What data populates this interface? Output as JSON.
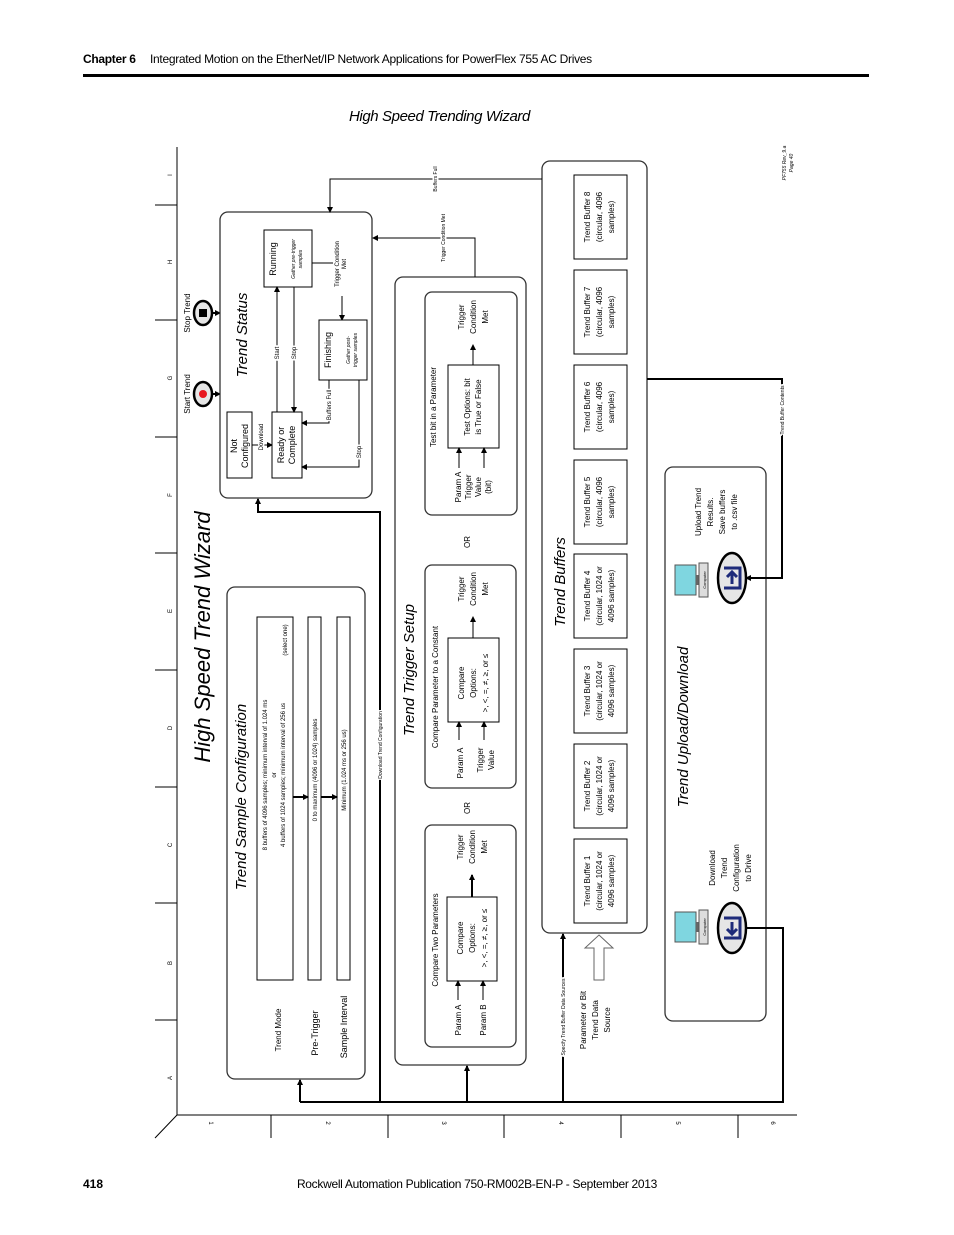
{
  "header": {
    "chapter": "Chapter 6",
    "title": "Integrated Motion on the EtherNet/IP Network Applications for PowerFlex 755 AC Drives"
  },
  "figure_title": "High Speed Trending Wizard",
  "diagram": {
    "title": "High Speed Trend Wizard",
    "grid": {
      "columns": [
        "A",
        "B",
        "C",
        "D",
        "E",
        "F",
        "G",
        "H",
        "I"
      ],
      "rows": [
        "1",
        "2",
        "3",
        "4",
        "5",
        "6"
      ]
    },
    "revision": [
      "PF755 Rev_9.a",
      "Page 40"
    ],
    "controls": {
      "start": "Start Trend",
      "stop": "Stop Trend",
      "start_color": "#e8171f"
    },
    "trend_status": {
      "title": "Trend Status",
      "not_configured": [
        "Not",
        "Configured"
      ],
      "download": "Download",
      "ready": [
        "Ready or",
        "Complete"
      ],
      "running": "Running",
      "running_note": [
        "Gather pre-trigger",
        "samples"
      ],
      "finishing": "Finishing",
      "finishing_note": [
        "Gather post-",
        "trigger samples"
      ],
      "start": "Start",
      "stop": "Stop",
      "buffers_full": "Buffers Full",
      "stop_finishing": "Stop",
      "trigger_met": [
        "Trigger Condition",
        "Met"
      ]
    },
    "sample_config": {
      "title": "Trend Sample Configuration",
      "trend_mode": "Trend Mode",
      "trend_mode_options": [
        "8 buffers of 4096 samples; minimum interval of 1.024 ms",
        "or",
        "4 buffers of 1024 samples; minimum interval of 256 us"
      ],
      "select_one": "(select one)",
      "pre_trigger": "Pre-Trigger",
      "pre_trigger_value": "0 to maximum (4096 or 1024) samples",
      "sample_interval": "Sample Interval",
      "sample_interval_value": "Minimum (1.024 ms or 256 us)"
    },
    "trigger_setup": {
      "title": "Trend Trigger Setup",
      "or": "OR",
      "two_params": {
        "title": "Compare Two Parameters",
        "options": [
          "Compare",
          "Options:",
          ">, <, =, ≠, ≥, or ≤"
        ],
        "param_a": "Param A",
        "param_b": "Param B",
        "result": [
          "Trigger",
          "Condition",
          "Met"
        ]
      },
      "constant": {
        "title": "Compare Parameter to a Constant",
        "options": [
          "Compare",
          "Options:",
          ">, <, =, ≠, ≥, or ≤"
        ],
        "param_a": "Param A",
        "trigger_value": [
          "Trigger",
          "Value"
        ],
        "result": [
          "Trigger",
          "Condition",
          "Met"
        ]
      },
      "bit": {
        "title": "Test bit in a Parameter",
        "options": [
          "Test Options: bit",
          "is True or False"
        ],
        "inputs": [
          "Param A",
          "Trigger",
          "Value",
          "(bit)"
        ],
        "result": [
          "Trigger",
          "Condition",
          "Met"
        ]
      }
    },
    "buffers": {
      "title": "Trend Buffers",
      "items": [
        [
          "Trend Buffer 1",
          "(circular, 1024 or",
          "4096 samples)"
        ],
        [
          "Trend Buffer 2",
          "(circular, 1024 or",
          "4096 samples)"
        ],
        [
          "Trend Buffer 3",
          "(circular, 1024 or",
          "4096 samples)"
        ],
        [
          "Trend Buffer 4",
          "(circular, 1024 or",
          "4096 samples)"
        ],
        [
          "Trend Buffer 5",
          "(circular, 4096",
          "samples)"
        ],
        [
          "Trend Buffer 6",
          "(circular, 4096",
          "samples)"
        ],
        [
          "Trend Buffer 7",
          "(circular, 4096",
          "samples)"
        ],
        [
          "Trend Buffer 8",
          "(circular, 4096",
          "samples)"
        ]
      ]
    },
    "upload_download": {
      "title": "Trend Upload/Download",
      "computer_label": "Computer",
      "download": [
        "Download",
        "Trend",
        "Configuration",
        "to Drive"
      ],
      "upload": [
        "Upload Trend",
        "Results.",
        "Save buffers",
        "to .csv file"
      ]
    },
    "connectors": {
      "download_config": "Download Trend Configuration",
      "specify_sources": "Specify Trend Buffer Data Sources",
      "buffer_contents": "Trend Buffer Contents",
      "trigger_met": "Trigger Condition Met",
      "buffers_full": "Buffers Full",
      "data_source": [
        "Parameter or Bit",
        "Trend Data",
        "Source"
      ]
    }
  },
  "footer": {
    "page": "418",
    "publication": "Rockwell Automation Publication 750-RM002B-EN-P - September 2013"
  }
}
